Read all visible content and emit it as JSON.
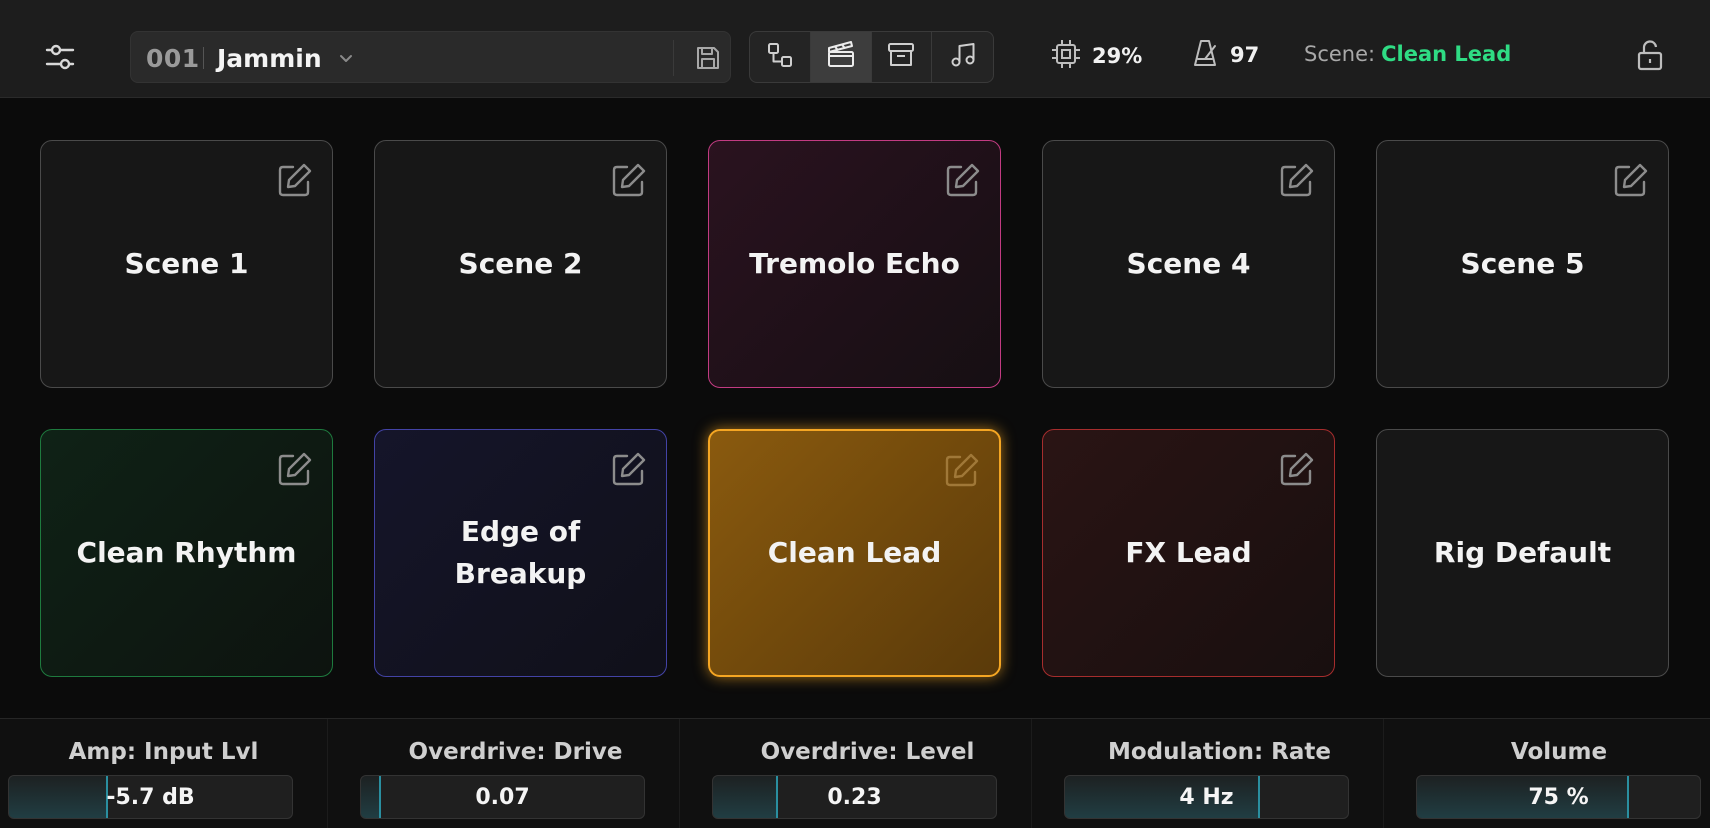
{
  "header": {
    "preset_number": "001",
    "preset_name": "Jammin",
    "cpu_value": "29%",
    "tempo_value": "97",
    "scene_label": "Scene:",
    "scene_value": "Clean Lead"
  },
  "view_buttons": [
    {
      "icon": "signal-chain-icon",
      "active": false
    },
    {
      "icon": "clapperboard-icon",
      "active": true
    },
    {
      "icon": "archive-box-icon",
      "active": false
    },
    {
      "icon": "music-note-icon",
      "active": false
    }
  ],
  "scenes": [
    {
      "name": "Scene 1",
      "color": "default",
      "editable": true
    },
    {
      "name": "Scene 2",
      "color": "default",
      "editable": true
    },
    {
      "name": "Tremolo Echo",
      "color": "pink",
      "editable": true
    },
    {
      "name": "Scene 4",
      "color": "default",
      "editable": true
    },
    {
      "name": "Scene 5",
      "color": "default",
      "editable": true
    },
    {
      "name": "Clean Rhythm",
      "color": "green",
      "editable": true
    },
    {
      "name": "Edge of Breakup",
      "color": "blue",
      "editable": true
    },
    {
      "name": "Clean Lead",
      "color": "orange",
      "editable": true,
      "selected": true
    },
    {
      "name": "FX Lead",
      "color": "red",
      "editable": true
    },
    {
      "name": "Rig Default",
      "color": "default",
      "editable": false
    }
  ],
  "params": [
    {
      "label": "Amp: Input Lvl",
      "value": "-5.7 dB",
      "level": 0.35
    },
    {
      "label": "Overdrive: Drive",
      "value": "0.07",
      "level": 0.07
    },
    {
      "label": "Overdrive: Level",
      "value": "0.23",
      "level": 0.23
    },
    {
      "label": "Modulation: Rate",
      "value": "4 Hz",
      "level": 0.69
    },
    {
      "label": "Volume",
      "value": "75 %",
      "level": 0.75
    }
  ],
  "colors": {
    "accent_green": "#2fdc84",
    "selected_orange": "#f5a623",
    "param_fill": "#2a8fa0"
  }
}
